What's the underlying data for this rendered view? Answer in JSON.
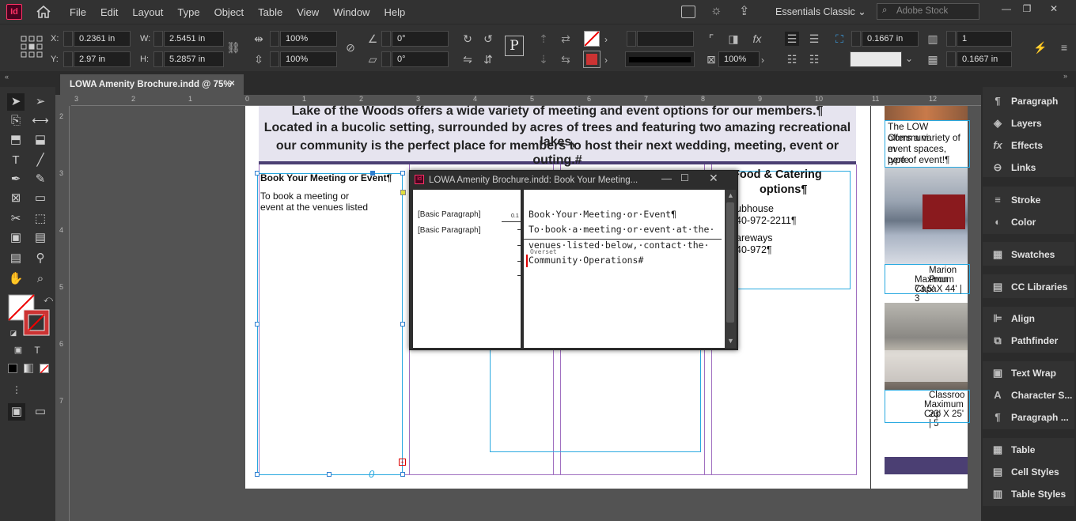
{
  "app": {
    "logo": "Id",
    "menus": [
      "File",
      "Edit",
      "Layout",
      "Type",
      "Object",
      "Table",
      "View",
      "Window",
      "Help"
    ],
    "workspace": "Essentials Classic",
    "search_placeholder": "Adobe Stock"
  },
  "control": {
    "x_label": "X:",
    "x_value": "0.2361 in",
    "y_label": "Y:",
    "y_value": "2.97 in",
    "w_label": "W:",
    "w_value": "2.5451 in",
    "h_label": "H:",
    "h_value": "5.2857 in",
    "scale_x": "100%",
    "scale_y": "100%",
    "rotate": "0°",
    "shear": "0°",
    "stroke_pct": "100%",
    "gutter_top": "0.1667 in",
    "gutter_bottom": "0.1667 in",
    "columns": "1"
  },
  "document": {
    "tab_title": "LOWA Amenity Brochure.indd @ 75%",
    "close": "×"
  },
  "ruler": {
    "h_ticks": [
      "3",
      "2",
      "1",
      "0",
      "1",
      "2",
      "3",
      "4",
      "5",
      "6",
      "7",
      "8",
      "9",
      "10",
      "11",
      "12"
    ],
    "v_ticks": [
      "2",
      "3",
      "4",
      "5",
      "6",
      "7"
    ]
  },
  "page": {
    "header_lines": [
      "Lake of the Woods offers a wide variety of meeting and event options for our members.¶",
      "Located in a bucolic setting, surrounded by acres of trees and featuring two amazing recreational lakes,",
      "our community is the perfect place for members to host their next wedding, meeting, event or outing.#"
    ],
    "book_heading": "Book Your Meeting or Event¶",
    "book_body_1": "To book a meeting or",
    "book_body_2": "event at the venues listed",
    "food_heading_1": "Food & Catering",
    "food_heading_2": "options¶",
    "food_line_1": "ubhouse",
    "food_line_2": "40-972-2211¶",
    "food_line_3": "areways",
    "food_line_4": "40-972¶",
    "overflow_symbol": "0",
    "low_text_1": "The LOW Communi",
    "low_text_2": "offers a variety of m",
    "low_text_3": "event spaces, perfe",
    "low_text_4": "type of event!¶",
    "marion_1": "Marion Pron",
    "marion_2": "Maximum Capa",
    "marion_3": "73.5' X 44'  |  3",
    "class_1": "Classroo",
    "class_2": "Maximum Cap",
    "class_3": "23' X 25'  |  5"
  },
  "story_editor": {
    "title": "LOWA Amenity Brochure.indd: Book Your Meeting...",
    "style_1": "[Basic Paragraph]",
    "style_2": "[Basic Paragraph]",
    "depth": "0.1",
    "line_1": "Book·Your·Meeting·or·Event¶",
    "line_2": "To·book·a·meeting·or·event·at·the·",
    "line_3": "venues·listed·below,·contact·the·",
    "line_4": "Community·Operations#",
    "overset": "Overset"
  },
  "panels": [
    [
      "Paragraph",
      "Layers",
      "Effects",
      "Links"
    ],
    [
      "Stroke",
      "Color"
    ],
    [
      "Swatches"
    ],
    [
      "CC Libraries"
    ],
    [
      "Align",
      "Pathfinder"
    ],
    [
      "Text Wrap",
      "Character S...",
      "Paragraph ..."
    ],
    [
      "Table",
      "Cell Styles",
      "Table Styles"
    ]
  ],
  "colors": {
    "accent_purple": "#4b3f73",
    "frame_blue": "#29a9e0",
    "panel_bg": "#323232",
    "canvas": "#535353"
  }
}
